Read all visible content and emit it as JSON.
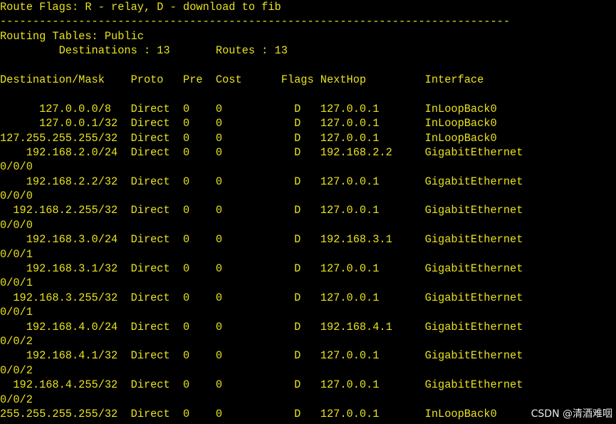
{
  "terminal": {
    "text_color": "#e8e21e",
    "background_color": "#000000",
    "lines": [
      "Route Flags: R - relay, D - download to fib",
      "------------------------------------------------------------------------------",
      "Routing Tables: Public",
      "         Destinations : 13       Routes : 13",
      "",
      "Destination/Mask    Proto   Pre  Cost      Flags NextHop         Interface",
      "",
      "      127.0.0.0/8   Direct  0    0           D   127.0.0.1       InLoopBack0",
      "      127.0.0.1/32  Direct  0    0           D   127.0.0.1       InLoopBack0",
      "127.255.255.255/32  Direct  0    0           D   127.0.0.1       InLoopBack0",
      "    192.168.2.0/24  Direct  0    0           D   192.168.2.2     GigabitEthernet",
      "0/0/0",
      "    192.168.2.2/32  Direct  0    0           D   127.0.0.1       GigabitEthernet",
      "0/0/0",
      "  192.168.2.255/32  Direct  0    0           D   127.0.0.1       GigabitEthernet",
      "0/0/0",
      "    192.168.3.0/24  Direct  0    0           D   192.168.3.1     GigabitEthernet",
      "0/0/1",
      "    192.168.3.1/32  Direct  0    0           D   127.0.0.1       GigabitEthernet",
      "0/0/1",
      "  192.168.3.255/32  Direct  0    0           D   127.0.0.1       GigabitEthernet",
      "0/0/1",
      "    192.168.4.0/24  Direct  0    0           D   192.168.4.1     GigabitEthernet",
      "0/0/2",
      "    192.168.4.1/32  Direct  0    0           D   127.0.0.1       GigabitEthernet",
      "0/0/2",
      "  192.168.4.255/32  Direct  0    0           D   127.0.0.1       GigabitEthernet",
      "0/0/2",
      "255.255.255.255/32  Direct  0    0           D   127.0.0.1       InLoopBack0"
    ]
  },
  "watermark": {
    "text": "CSDN @清酒难咽",
    "color": "#e9e9e9"
  }
}
